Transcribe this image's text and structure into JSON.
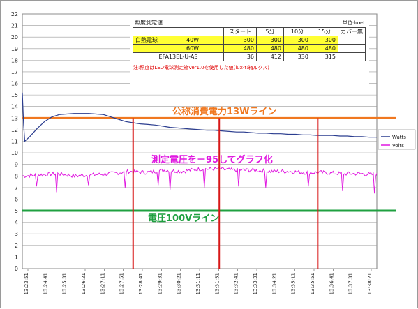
{
  "chart_data": {
    "type": "line",
    "ylim": [
      0,
      22
    ],
    "yticks": [
      0,
      1,
      2,
      3,
      4,
      5,
      6,
      7,
      8,
      9,
      10,
      11,
      12,
      13,
      14,
      15,
      16,
      17,
      18,
      19,
      20,
      21,
      22
    ],
    "xticks": [
      "13:23:51",
      "13:24:41",
      "13:25:31",
      "13:26:21",
      "13:27:11",
      "13:27:51",
      "13:28:41",
      "13:29:31",
      "13:30:21",
      "13:31:11",
      "13:31:51",
      "13:32:41",
      "13:33:31",
      "13:34:21",
      "13:35:11",
      "13:35:51",
      "13:36:41",
      "13:37:31",
      "13:38:21"
    ],
    "grid": true,
    "legend_position": "right",
    "series": [
      {
        "name": "Watts",
        "color": "#2b3d8f",
        "x": [
          0,
          0.5,
          1,
          3,
          6,
          9,
          12,
          15,
          18,
          21,
          24,
          27,
          30,
          33,
          36,
          39,
          42,
          45,
          48,
          51,
          54,
          57,
          60,
          63,
          66,
          69,
          72,
          75,
          78,
          81,
          84,
          87,
          90,
          93,
          96,
          99,
          102,
          105,
          108,
          111,
          114,
          117,
          120,
          123,
          126,
          129,
          132,
          135,
          138,
          141,
          144
        ],
        "values": [
          15.2,
          12.5,
          11.0,
          11.4,
          12.1,
          12.7,
          13.1,
          13.3,
          13.35,
          13.4,
          13.4,
          13.4,
          13.35,
          13.3,
          13.1,
          12.9,
          12.7,
          12.6,
          12.5,
          12.45,
          12.4,
          12.3,
          12.2,
          12.15,
          12.1,
          12.05,
          12.0,
          11.95,
          11.95,
          11.9,
          11.85,
          11.8,
          11.8,
          11.75,
          11.7,
          11.7,
          11.65,
          11.65,
          11.6,
          11.6,
          11.55,
          11.55,
          11.5,
          11.5,
          11.5,
          11.45,
          11.45,
          11.4,
          11.4,
          11.35,
          11.35
        ]
      },
      {
        "name": "Volts",
        "color": "#e018e0",
        "baseline": 8.1,
        "values": [
          8.0,
          8.1,
          8.2,
          8.0,
          8.1,
          8.2,
          8.4,
          8.3,
          8.5,
          8.4,
          8.6,
          8.6,
          8.5,
          8.5,
          8.4,
          8.4,
          8.3,
          8.3,
          8.2,
          8.2,
          8.1
        ]
      }
    ],
    "dips": [
      {
        "x": 6,
        "y": 7.1
      },
      {
        "x": 14,
        "y": 6.6
      },
      {
        "x": 27,
        "y": 7.2
      },
      {
        "x": 42,
        "y": 7.0
      },
      {
        "x": 55,
        "y": 7.2
      },
      {
        "x": 60,
        "y": 6.8
      },
      {
        "x": 74,
        "y": 7.0
      },
      {
        "x": 88,
        "y": 7.1
      },
      {
        "x": 99,
        "y": 7.0
      },
      {
        "x": 116,
        "y": 7.1
      },
      {
        "x": 130,
        "y": 6.7
      },
      {
        "x": 143,
        "y": 6.5
      }
    ],
    "reference_lines": [
      {
        "value": 13,
        "color": "#f07820",
        "label": "公称消費電力13Wライン",
        "label_color": "#f07820"
      },
      {
        "value": 5,
        "color": "#1fa040",
        "label": "電圧100Vライン",
        "label_color": "#1fa040"
      }
    ],
    "marker_lines": [
      {
        "x": 45,
        "color": "#d81818"
      },
      {
        "x": 80,
        "color": "#d81818"
      },
      {
        "x": 120,
        "color": "#d81818"
      }
    ],
    "annotation": {
      "text": "測定電圧を－95してグラフ化",
      "color": "#e018e0"
    },
    "x_domain": [
      0,
      144
    ]
  },
  "lux_table": {
    "title": "照度測定値",
    "unit": "単位:lux-t",
    "header": [
      "",
      "",
      "スタート",
      "5分",
      "10分",
      "15分",
      "カバー無"
    ],
    "rows": [
      {
        "c0": "白熱電球",
        "c1": "40W",
        "v": [
          "300",
          "300",
          "300",
          "300"
        ],
        "highlight": true
      },
      {
        "c0": "",
        "c1": "60W",
        "v": [
          "480",
          "480",
          "480",
          "480"
        ],
        "highlight": true
      },
      {
        "c0": "EFA13EL-U-AS",
        "c1": "",
        "v": [
          "36",
          "412",
          "330",
          "315"
        ],
        "highlight": false
      }
    ],
    "note": "注:照度はLED電球測定箱Ver1.0を使用した値(lux-t:箱ルクス)"
  }
}
